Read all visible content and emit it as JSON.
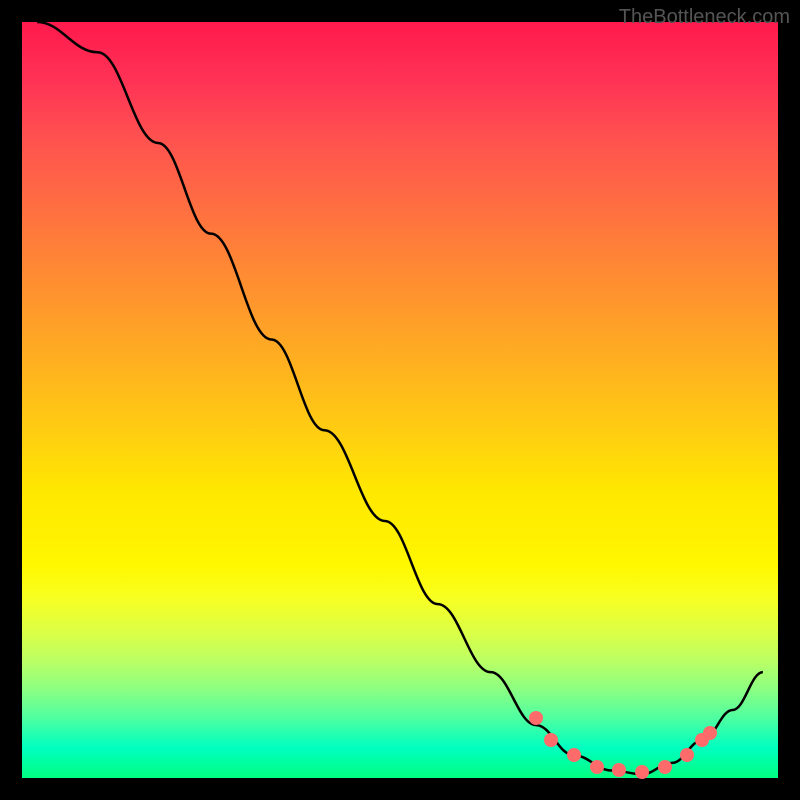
{
  "watermark": "TheBottleneck.com",
  "chart_data": {
    "type": "line",
    "title": "",
    "xlabel": "",
    "ylabel": "",
    "xlim": [
      0,
      100
    ],
    "ylim": [
      0,
      100
    ],
    "curve_points": [
      {
        "x": 2,
        "y": 100
      },
      {
        "x": 10,
        "y": 96
      },
      {
        "x": 18,
        "y": 84
      },
      {
        "x": 25,
        "y": 72
      },
      {
        "x": 33,
        "y": 58
      },
      {
        "x": 40,
        "y": 46
      },
      {
        "x": 48,
        "y": 34
      },
      {
        "x": 55,
        "y": 23
      },
      {
        "x": 62,
        "y": 14
      },
      {
        "x": 68,
        "y": 7
      },
      {
        "x": 73,
        "y": 3
      },
      {
        "x": 78,
        "y": 1
      },
      {
        "x": 82,
        "y": 0.5
      },
      {
        "x": 86,
        "y": 2
      },
      {
        "x": 90,
        "y": 5
      },
      {
        "x": 94,
        "y": 9
      },
      {
        "x": 98,
        "y": 14
      }
    ],
    "highlighted_points": [
      {
        "x": 68,
        "y": 8
      },
      {
        "x": 70,
        "y": 5
      },
      {
        "x": 73,
        "y": 3
      },
      {
        "x": 76,
        "y": 1.5
      },
      {
        "x": 79,
        "y": 1
      },
      {
        "x": 82,
        "y": 0.8
      },
      {
        "x": 85,
        "y": 1.5
      },
      {
        "x": 88,
        "y": 3
      },
      {
        "x": 90,
        "y": 5
      },
      {
        "x": 91,
        "y": 6
      }
    ]
  }
}
